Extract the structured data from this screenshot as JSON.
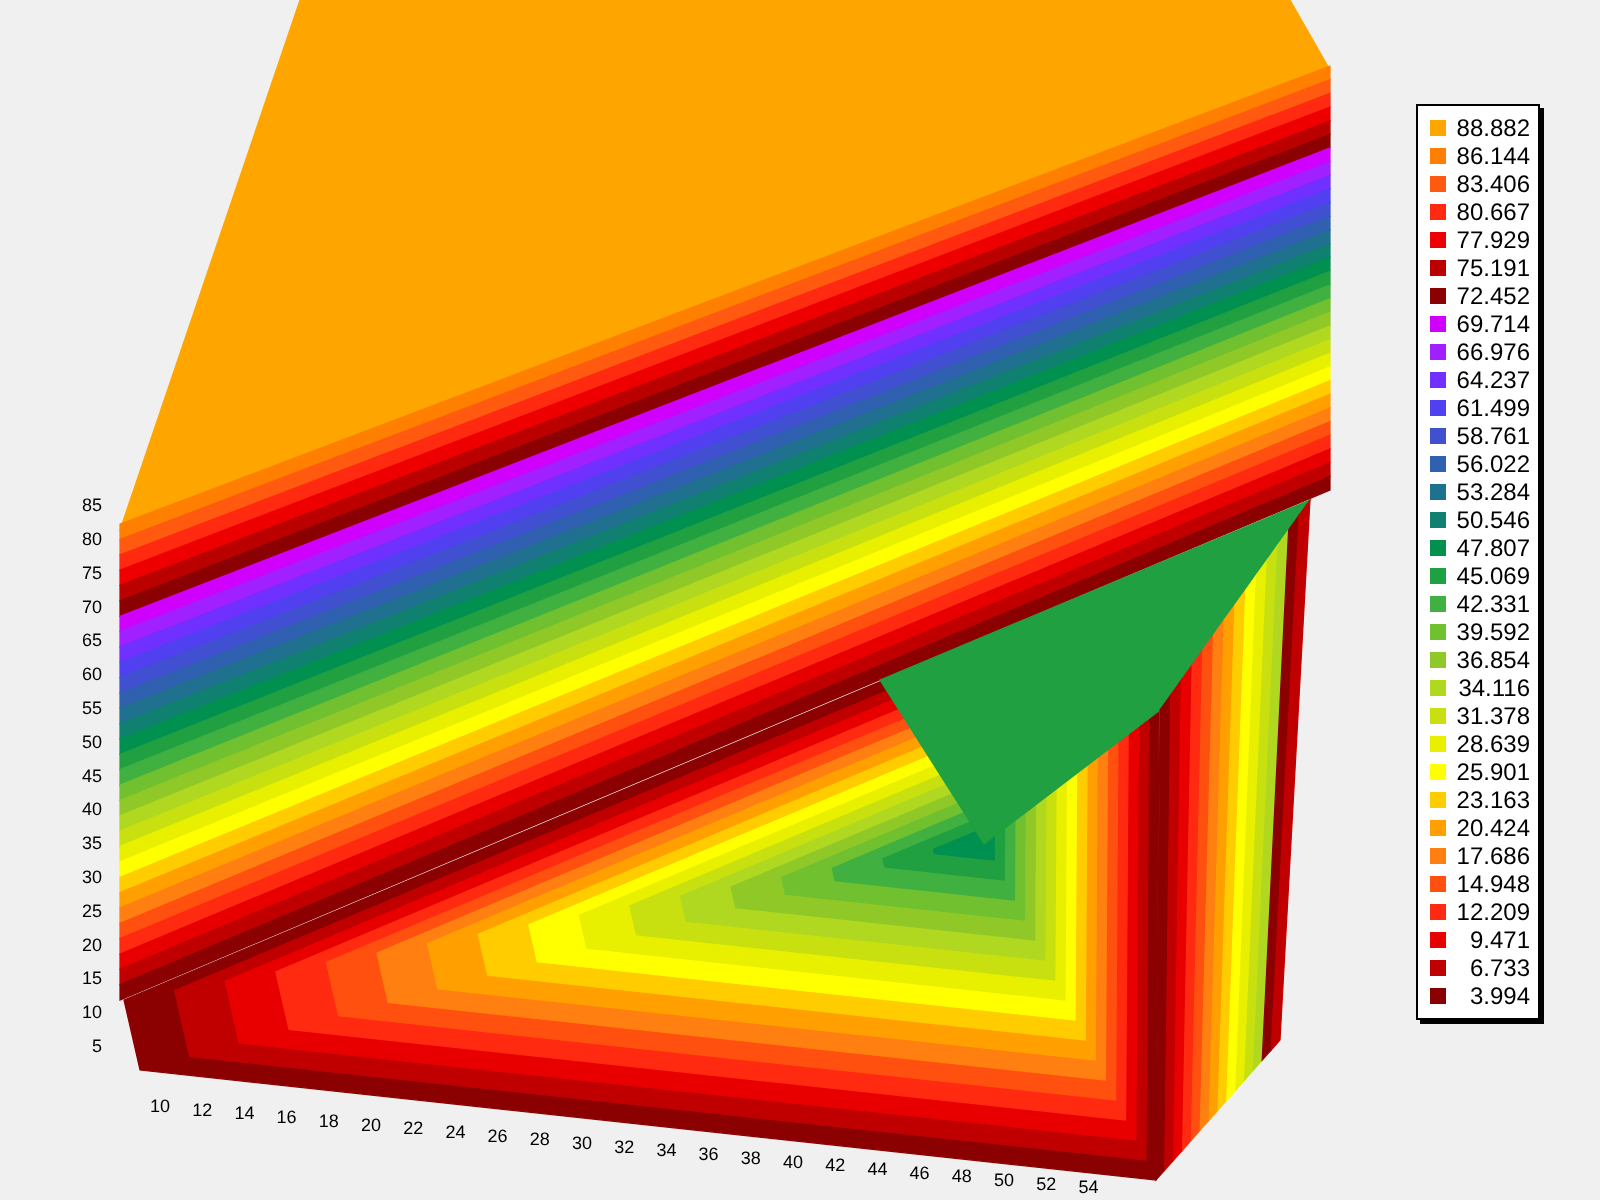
{
  "legend": {
    "items": [
      {
        "label": "88.882",
        "color": "#ffa500"
      },
      {
        "label": "86.144",
        "color": "#ff8000"
      },
      {
        "label": "83.406",
        "color": "#ff5a10"
      },
      {
        "label": "80.667",
        "color": "#ff2a10"
      },
      {
        "label": "77.929",
        "color": "#ee0000"
      },
      {
        "label": "75.191",
        "color": "#bb0000"
      },
      {
        "label": "72.452",
        "color": "#8b0000"
      },
      {
        "label": "69.714",
        "color": "#d000ff"
      },
      {
        "label": "66.976",
        "color": "#a020ff"
      },
      {
        "label": "64.237",
        "color": "#7030ff"
      },
      {
        "label": "61.499",
        "color": "#5040f0"
      },
      {
        "label": "58.761",
        "color": "#4050d0"
      },
      {
        "label": "56.022",
        "color": "#3060b0"
      },
      {
        "label": "53.284",
        "color": "#207090"
      },
      {
        "label": "50.546",
        "color": "#108070"
      },
      {
        "label": "47.807",
        "color": "#009050"
      },
      {
        "label": "45.069",
        "color": "#20a040"
      },
      {
        "label": "42.331",
        "color": "#40b040"
      },
      {
        "label": "39.592",
        "color": "#70c030"
      },
      {
        "label": "36.854",
        "color": "#90c828"
      },
      {
        "label": "34.116",
        "color": "#b0d820"
      },
      {
        "label": "31.378",
        "color": "#c8e010"
      },
      {
        "label": "28.639",
        "color": "#e8f000"
      },
      {
        "label": "25.901",
        "color": "#ffff00"
      },
      {
        "label": "23.163",
        "color": "#ffcc00"
      },
      {
        "label": "20.424",
        "color": "#ffa000"
      },
      {
        "label": "17.686",
        "color": "#ff8010"
      },
      {
        "label": "14.948",
        "color": "#ff5010"
      },
      {
        "label": "12.209",
        "color": "#ff2a10"
      },
      {
        "label": "9.471",
        "color": "#e80000"
      },
      {
        "label": "6.733",
        "color": "#c00000"
      },
      {
        "label": "3.994",
        "color": "#8b0000"
      }
    ]
  },
  "axes": {
    "vertical_ticks": [
      "85",
      "80",
      "75",
      "70",
      "65",
      "60",
      "55",
      "50",
      "45",
      "40",
      "35",
      "30",
      "25",
      "20",
      "15",
      "10",
      "5"
    ],
    "horizontal_ticks": [
      "10",
      "12",
      "14",
      "16",
      "18",
      "20",
      "22",
      "24",
      "26",
      "28",
      "30",
      "32",
      "34",
      "36",
      "38",
      "40",
      "42",
      "44",
      "46",
      "48",
      "50",
      "52",
      "54"
    ]
  }
}
